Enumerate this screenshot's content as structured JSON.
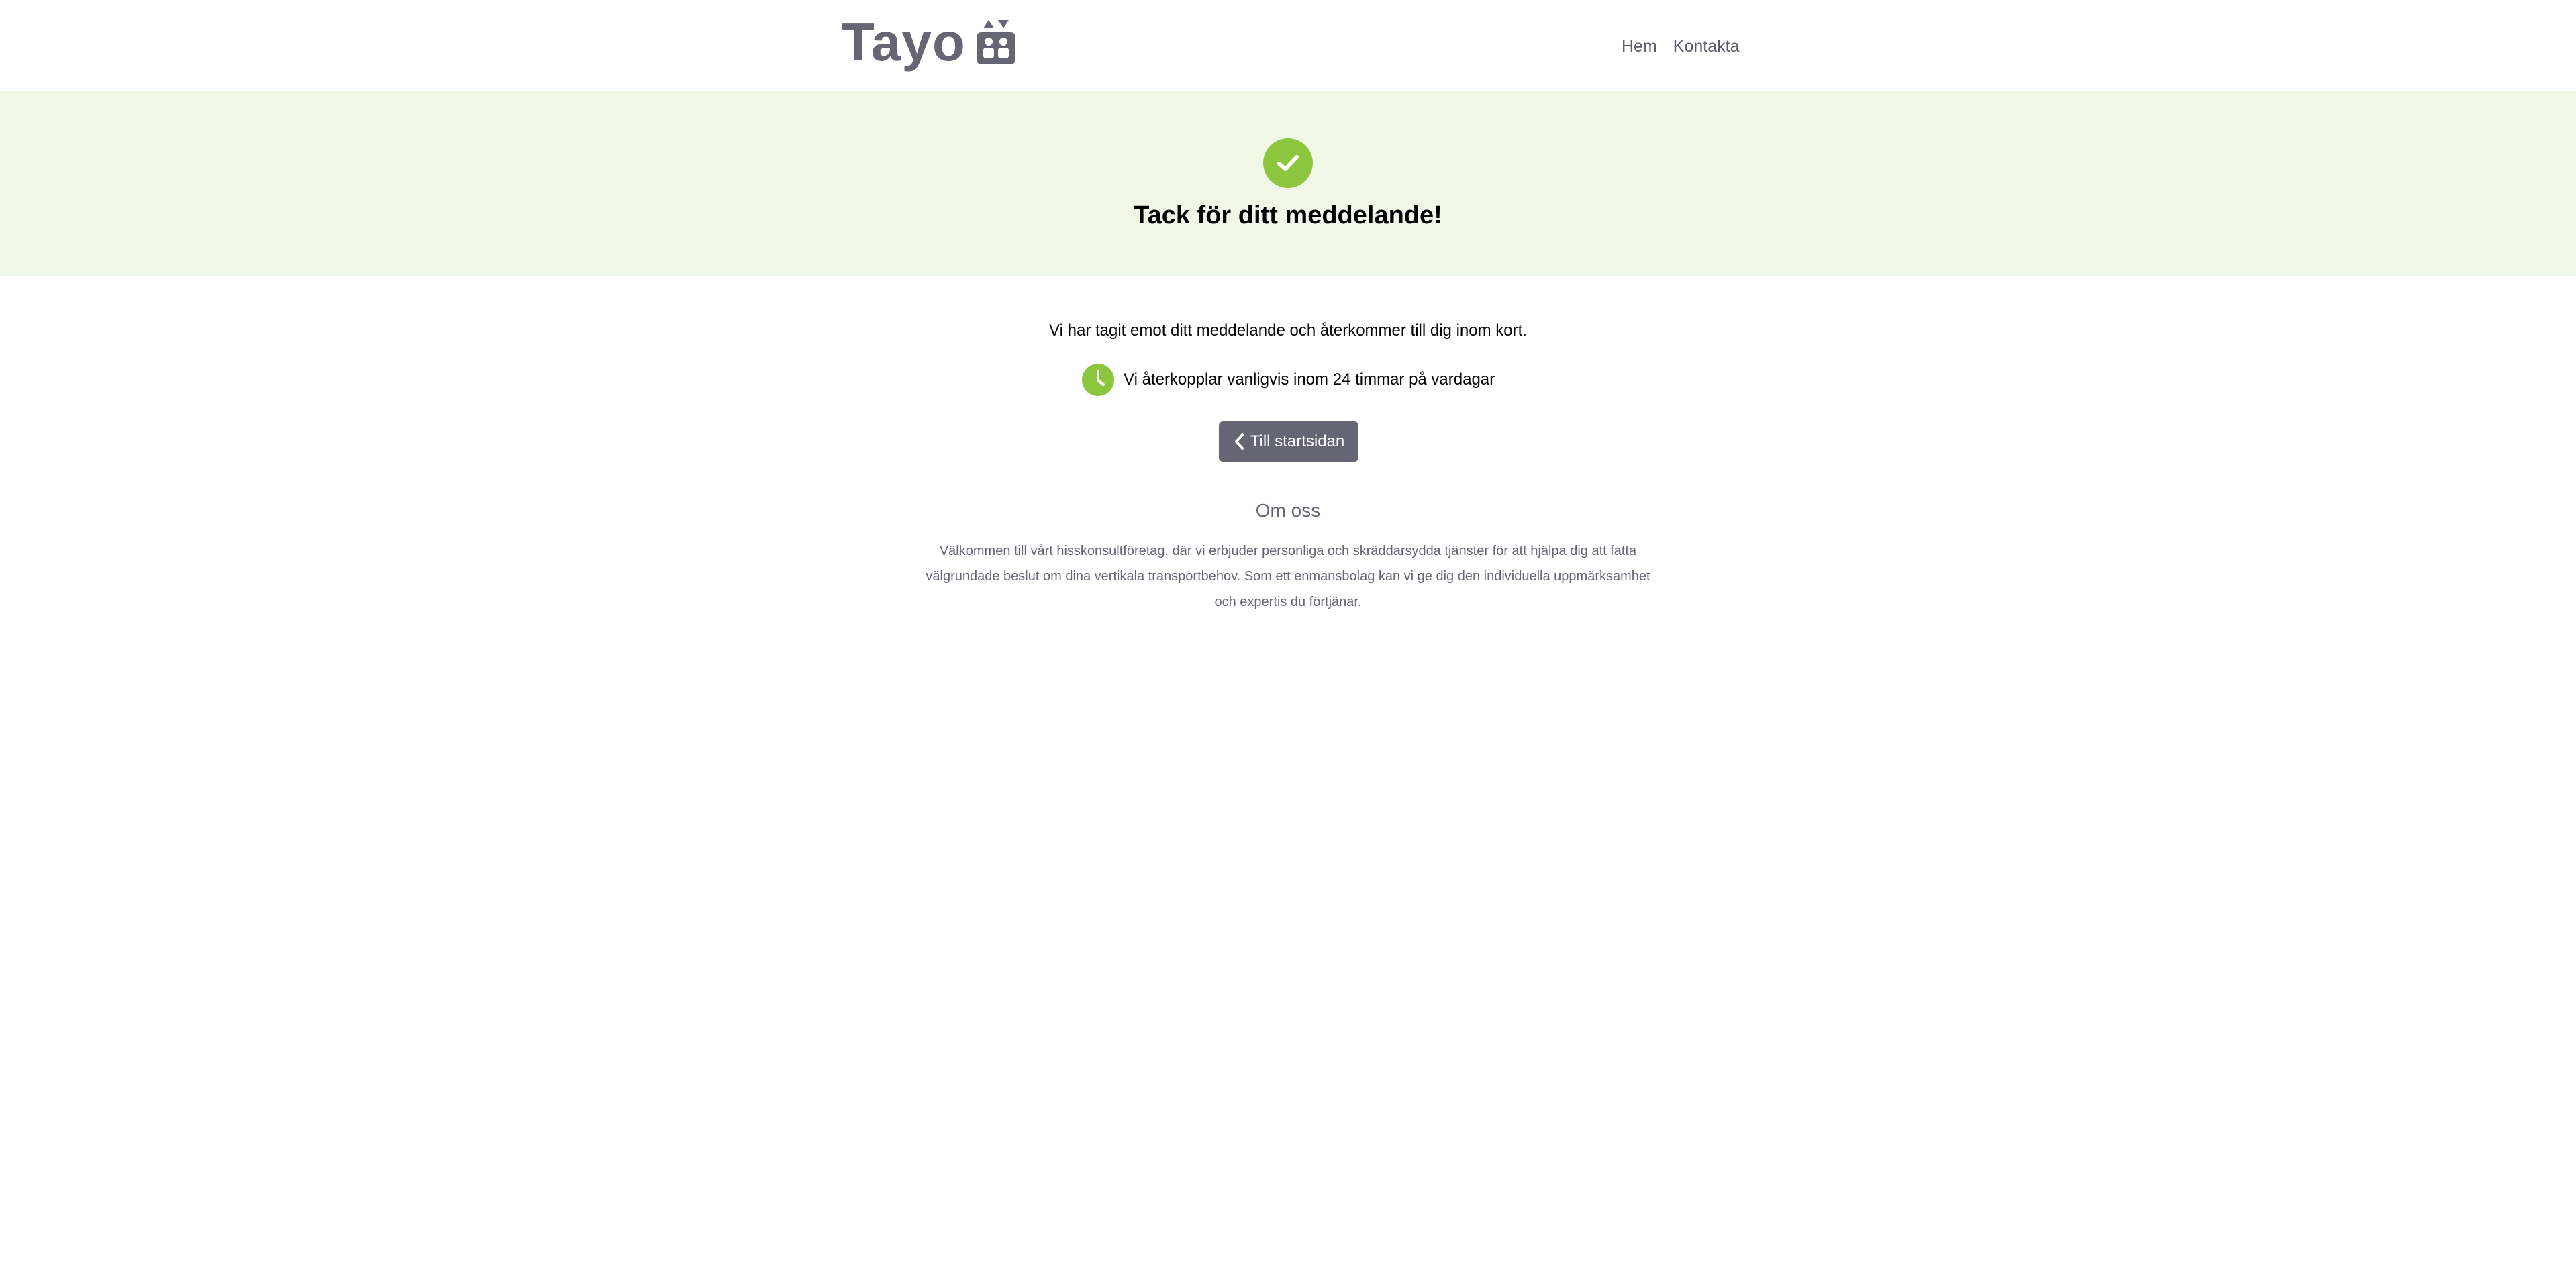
{
  "header": {
    "logo_text": "Tayo",
    "nav": [
      {
        "label": "Hem"
      },
      {
        "label": "Kontakta"
      }
    ]
  },
  "banner": {
    "title": "Tack för ditt meddelande!"
  },
  "main": {
    "message": "Vi har tagit emot ditt meddelande och återkommer till dig inom kort.",
    "notice": "Vi återkopplar vanligvis inom 24 timmar på vardagar",
    "back_button_label": "Till startsidan"
  },
  "about": {
    "heading": "Om oss",
    "text": "Välkommen till vårt hisskonsultföretag, där vi erbjuder personliga och skräddarsydda tjänster för att hjälpa dig att fatta välgrundade beslut om dina vertikala transportbehov. Som ett enmansbolag kan vi ge dig den individuella uppmärksamhet och expertis du förtjänar."
  },
  "icons": {
    "logo": "elevator-icon",
    "success": "check-circle-icon",
    "notice": "clock-icon",
    "back": "chevron-left-icon"
  },
  "colors": {
    "brand_gray": "#656573",
    "accent_green": "#8cc63f",
    "banner_bg": "#f0f7e7"
  }
}
